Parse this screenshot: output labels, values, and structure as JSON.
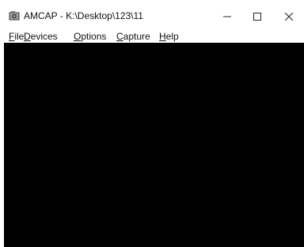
{
  "window": {
    "title": "AMCAP - K:\\Desktop\\123\\11",
    "controls": {
      "minimize": "minimize-icon",
      "maximize": "maximize-icon",
      "close": "close-icon"
    }
  },
  "menubar": {
    "items": [
      {
        "mnemonic": "F",
        "rest": "ile"
      },
      {
        "mnemonic": "D",
        "rest": "evices"
      },
      {
        "mnemonic": "O",
        "rest": "ptions"
      },
      {
        "mnemonic": "C",
        "rest": "apture"
      },
      {
        "mnemonic": "H",
        "rest": "elp"
      }
    ]
  },
  "preview": {
    "background": "#000000"
  }
}
